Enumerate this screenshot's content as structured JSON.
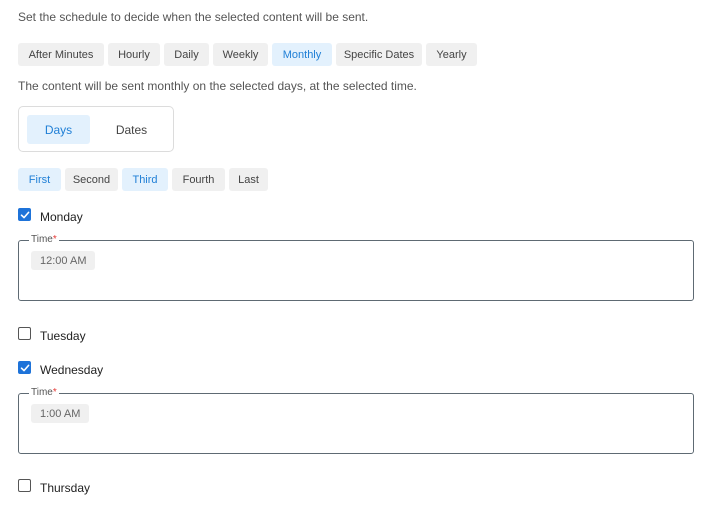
{
  "intro_text": "Set the schedule to decide when the selected content will be sent.",
  "frequency_tabs": [
    {
      "label": "After Minutes",
      "active": false
    },
    {
      "label": "Hourly",
      "active": false
    },
    {
      "label": "Daily",
      "active": false
    },
    {
      "label": "Weekly",
      "active": false
    },
    {
      "label": "Monthly",
      "active": true
    },
    {
      "label": "Specific Dates",
      "active": false
    },
    {
      "label": "Yearly",
      "active": false
    }
  ],
  "monthly_description": "The content will be sent monthly on the selected days, at the selected time.",
  "mode_toggle": [
    {
      "label": "Days",
      "active": true
    },
    {
      "label": "Dates",
      "active": false
    }
  ],
  "week_ordinals": [
    {
      "label": "First",
      "active": true
    },
    {
      "label": "Second",
      "active": false
    },
    {
      "label": "Third",
      "active": true
    },
    {
      "label": "Fourth",
      "active": false
    },
    {
      "label": "Last",
      "active": false
    }
  ],
  "time_label": "Time",
  "required_marker": "*",
  "days": [
    {
      "name": "Monday",
      "checked": true,
      "time": "12:00 AM"
    },
    {
      "name": "Tuesday",
      "checked": false
    },
    {
      "name": "Wednesday",
      "checked": true,
      "time": "1:00 AM"
    },
    {
      "name": "Thursday",
      "checked": false
    }
  ],
  "colors": {
    "accent": "#1f7fd6",
    "accent_bg": "#e3f1fd",
    "checkbox_checked": "#1e73d9",
    "required": "#e53935"
  }
}
